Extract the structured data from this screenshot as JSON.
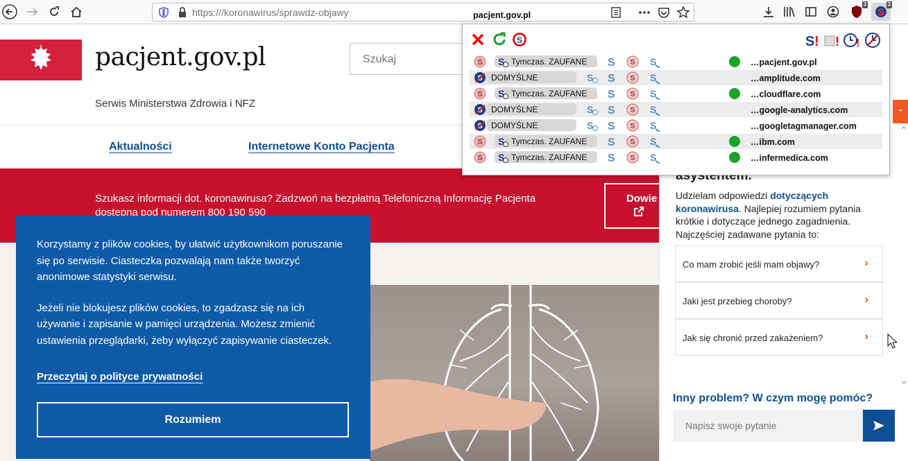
{
  "browser": {
    "url_scheme": "https://",
    "url_domain": "pacjent.gov.pl",
    "url_path": "/koronawirus/sprawdz-objawy",
    "ublock_count": "3",
    "noscript_count": "3"
  },
  "site": {
    "title": "pacjent.gov.pl",
    "subtitle": "Serwis Ministerstwa Zdrowia i NFZ",
    "search_placeholder": "Szukaj",
    "nav": [
      "Aktualności",
      "Internetowe Konto Pacjenta"
    ],
    "banner_text": "Szukasz informacji dot. koronawirusa? Zadzwoń na bezpłatną Telefoniczną Informację Pacjenta dostępną pod numerem 800 190 590",
    "banner_button": "Dowie"
  },
  "cookie": {
    "para1": "Korzystamy z plików cookies, by ułatwić użytkownikom poruszanie się po serwisie. Ciasteczka pozwalają nam także tworzyć anonimowe statystyki serwisu.",
    "para2": "Jeżeli nie blokujesz plików cookies, to zgadzasz się na ich używanie i zapisanie w pamięci urządzenia. Możesz zmienić ustawienia przeglądarki, żeby wyłączyć zapisywanie ciasteczek.",
    "policy_link": "Przeczytaj o polityce prywatności",
    "accept_button": "Rozumiem"
  },
  "chat": {
    "heading": "asystentem.",
    "intro_a": "Udzielam odpowiedzi ",
    "intro_hl1": "dotyczących",
    "intro_hl2": "koronawirusa",
    "intro_b": ". Najlepiej rozumiem pytania krótkie i dotyczące jednego zagadnienia. Najczęściej zadawane pytania to:",
    "faqs": [
      "Co mam zrobić jeśli mam objawy?",
      "Jaki jest przebieg choroby?",
      "Jak się chronić przed zakażeniem?"
    ],
    "other": "Inny problem? W czym mogę pomóc?",
    "input_placeholder": "Napisz swoje pytanie",
    "orange_tab": "-"
  },
  "noscript_popup": {
    "rows": [
      {
        "status": "Tymczas. ZAUFANE",
        "type": "temp",
        "domain_prefix": "…",
        "domain": "pacjent.gov.pl",
        "secure": true
      },
      {
        "status": "DOMYŚLNE",
        "type": "default",
        "domain_prefix": "…",
        "domain": "amplitude.com",
        "secure": false
      },
      {
        "status": "Tymczas. ZAUFANE",
        "type": "temp",
        "domain_prefix": "…",
        "domain": "cloudflare.com",
        "secure": true
      },
      {
        "status": "DOMYŚLNE",
        "type": "default",
        "domain_prefix": "…",
        "domain": "google-analytics.com",
        "secure": false
      },
      {
        "status": "DOMYŚLNE",
        "type": "default",
        "domain_prefix": "…",
        "domain": "googletagmanager.com",
        "secure": false
      },
      {
        "status": "Tymczas. ZAUFANE",
        "type": "temp",
        "domain_prefix": "…",
        "domain": "ibm.com",
        "secure": true
      },
      {
        "status": "Tymczas. ZAUFANE",
        "type": "temp",
        "domain_prefix": "…",
        "domain": "infermedica.com",
        "secure": true
      }
    ]
  },
  "colors": {
    "gov_red": "#c8102e",
    "gov_blue": "#0e5aa7",
    "link_blue": "#0b4f94",
    "accent_orange": "#f15a22"
  }
}
